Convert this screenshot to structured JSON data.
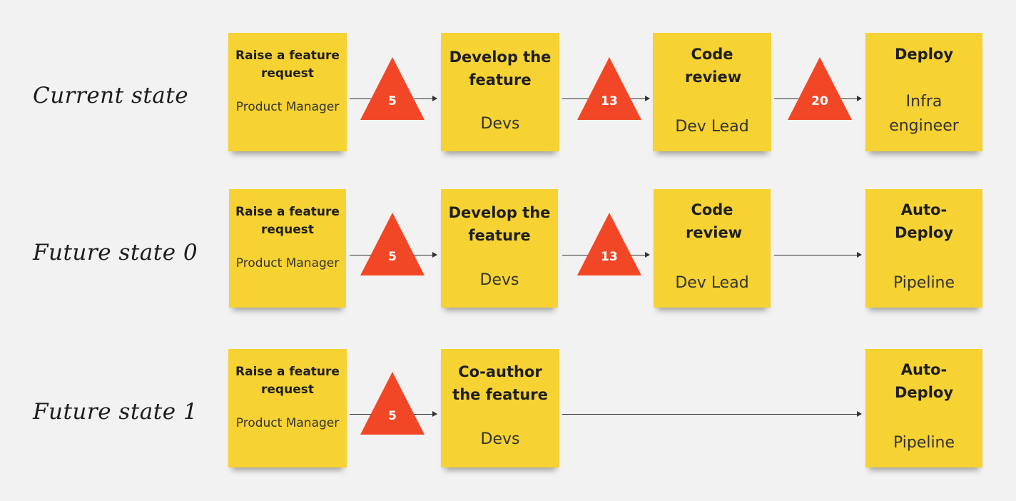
{
  "rows": [
    {
      "label": "Current state",
      "steps": [
        {
          "title": "Raise a feature request",
          "role": "Product Manager"
        },
        {
          "title": "Develop the feature",
          "role": "Devs"
        },
        {
          "title": "Code review",
          "role": "Dev Lead"
        },
        {
          "title": "Deploy",
          "role": "Infra engineer"
        }
      ],
      "delays": [
        "5",
        "13",
        "20"
      ]
    },
    {
      "label": "Future state 0",
      "steps": [
        {
          "title": "Raise a feature request",
          "role": "Product Manager"
        },
        {
          "title": "Develop the feature",
          "role": "Devs"
        },
        {
          "title": "Code review",
          "role": "Dev Lead"
        },
        {
          "title": "Auto-Deploy",
          "role": "Pipeline"
        }
      ],
      "delays": [
        "5",
        "13"
      ]
    },
    {
      "label": "Future state 1",
      "steps": [
        {
          "title": "Raise a feature request",
          "role": "Product Manager"
        },
        {
          "title": "Co-author the feature",
          "role": "Devs"
        },
        {
          "title": "Auto-Deploy",
          "role": "Pipeline"
        }
      ],
      "delays": [
        "5"
      ]
    }
  ],
  "colors": {
    "background": "#f2f2f2",
    "sticky_note": "#f6d233",
    "delay_triangle": "#f24726",
    "text": "#1e1e1e"
  }
}
